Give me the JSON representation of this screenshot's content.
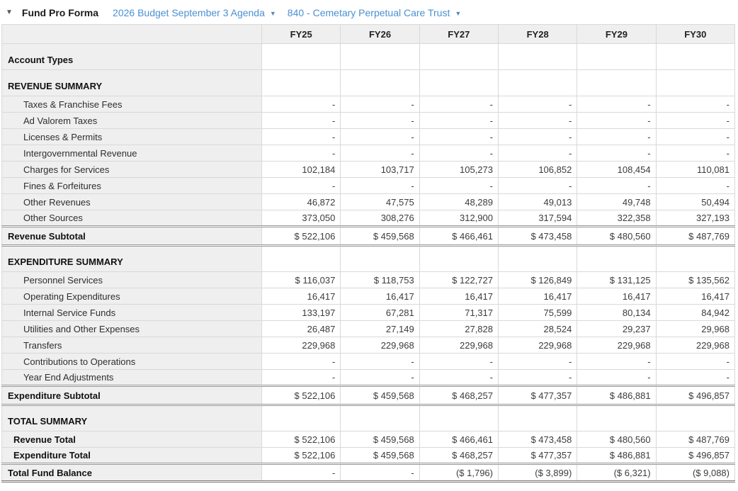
{
  "header": {
    "collapse_icon": "▼",
    "title": "Fund Pro Forma",
    "budget_dropdown": {
      "label": "2026 Budget September 3 Agenda",
      "arrow": "▼"
    },
    "fund_dropdown": {
      "label": "840 - Cemetary Perpetual Care Trust",
      "arrow": "▼"
    }
  },
  "colors": {
    "link_blue": "#4a90d2",
    "header_gray": "#efefef",
    "border_gray": "#d9d9d9"
  },
  "table": {
    "columns": [
      "FY25",
      "FY26",
      "FY27",
      "FY28",
      "FY29",
      "FY30"
    ],
    "rows": [
      {
        "label": "Account Types",
        "type": "section",
        "values": [
          "",
          "",
          "",
          "",
          "",
          ""
        ]
      },
      {
        "label": "REVENUE SUMMARY",
        "type": "section",
        "values": [
          "",
          "",
          "",
          "",
          "",
          ""
        ]
      },
      {
        "label": "Taxes & Franchise Fees",
        "type": "data",
        "values": [
          "-",
          "-",
          "-",
          "-",
          "-",
          "-"
        ]
      },
      {
        "label": "Ad Valorem Taxes",
        "type": "data",
        "values": [
          "-",
          "-",
          "-",
          "-",
          "-",
          "-"
        ]
      },
      {
        "label": "Licenses & Permits",
        "type": "data",
        "values": [
          "-",
          "-",
          "-",
          "-",
          "-",
          "-"
        ]
      },
      {
        "label": "Intergovernmental Revenue",
        "type": "data",
        "values": [
          "-",
          "-",
          "-",
          "-",
          "-",
          "-"
        ]
      },
      {
        "label": "Charges for Services",
        "type": "data",
        "values": [
          "102,184",
          "103,717",
          "105,273",
          "106,852",
          "108,454",
          "110,081"
        ]
      },
      {
        "label": "Fines & Forfeitures",
        "type": "data",
        "values": [
          "-",
          "-",
          "-",
          "-",
          "-",
          "-"
        ]
      },
      {
        "label": "Other Revenues",
        "type": "data",
        "values": [
          "46,872",
          "47,575",
          "48,289",
          "49,013",
          "49,748",
          "50,494"
        ]
      },
      {
        "label": "Other Sources",
        "type": "data",
        "values": [
          "373,050",
          "308,276",
          "312,900",
          "317,594",
          "322,358",
          "327,193"
        ]
      },
      {
        "label": "Revenue Subtotal",
        "type": "subtotal",
        "values": [
          "$ 522,106",
          "$ 459,568",
          "$ 466,461",
          "$ 473,458",
          "$ 480,560",
          "$ 487,769"
        ]
      },
      {
        "label": "EXPENDITURE SUMMARY",
        "type": "section",
        "values": [
          "",
          "",
          "",
          "",
          "",
          ""
        ]
      },
      {
        "label": "Personnel Services",
        "type": "data",
        "values": [
          "$ 116,037",
          "$ 118,753",
          "$ 122,727",
          "$ 126,849",
          "$ 131,125",
          "$ 135,562"
        ]
      },
      {
        "label": "Operating Expenditures",
        "type": "data",
        "values": [
          "16,417",
          "16,417",
          "16,417",
          "16,417",
          "16,417",
          "16,417"
        ]
      },
      {
        "label": "Internal Service Funds",
        "type": "data",
        "values": [
          "133,197",
          "67,281",
          "71,317",
          "75,599",
          "80,134",
          "84,942"
        ]
      },
      {
        "label": "Utilities and Other Expenses",
        "type": "data",
        "values": [
          "26,487",
          "27,149",
          "27,828",
          "28,524",
          "29,237",
          "29,968"
        ]
      },
      {
        "label": "Transfers",
        "type": "data",
        "values": [
          "229,968",
          "229,968",
          "229,968",
          "229,968",
          "229,968",
          "229,968"
        ]
      },
      {
        "label": "Contributions to Operations",
        "type": "data",
        "values": [
          "-",
          "-",
          "-",
          "-",
          "-",
          "-"
        ]
      },
      {
        "label": "Year End Adjustments",
        "type": "data",
        "values": [
          "-",
          "-",
          "-",
          "-",
          "-",
          "-"
        ]
      },
      {
        "label": "Expenditure Subtotal",
        "type": "subtotal",
        "values": [
          "$ 522,106",
          "$ 459,568",
          "$ 468,257",
          "$ 477,357",
          "$ 486,881",
          "$ 496,857"
        ]
      },
      {
        "label": "TOTAL SUMMARY",
        "type": "section",
        "values": [
          "",
          "",
          "",
          "",
          "",
          ""
        ]
      },
      {
        "label": "Revenue Total",
        "type": "total",
        "values": [
          "$ 522,106",
          "$ 459,568",
          "$ 466,461",
          "$ 473,458",
          "$ 480,560",
          "$ 487,769"
        ]
      },
      {
        "label": "Expenditure Total",
        "type": "total-end",
        "values": [
          "$ 522,106",
          "$ 459,568",
          "$ 468,257",
          "$ 477,357",
          "$ 486,881",
          "$ 496,857"
        ]
      },
      {
        "label": "Total Fund Balance",
        "type": "balance",
        "values": [
          "-",
          "-",
          "($ 1,796)",
          "($ 3,899)",
          "($ 6,321)",
          "($ 9,088)"
        ]
      }
    ]
  }
}
